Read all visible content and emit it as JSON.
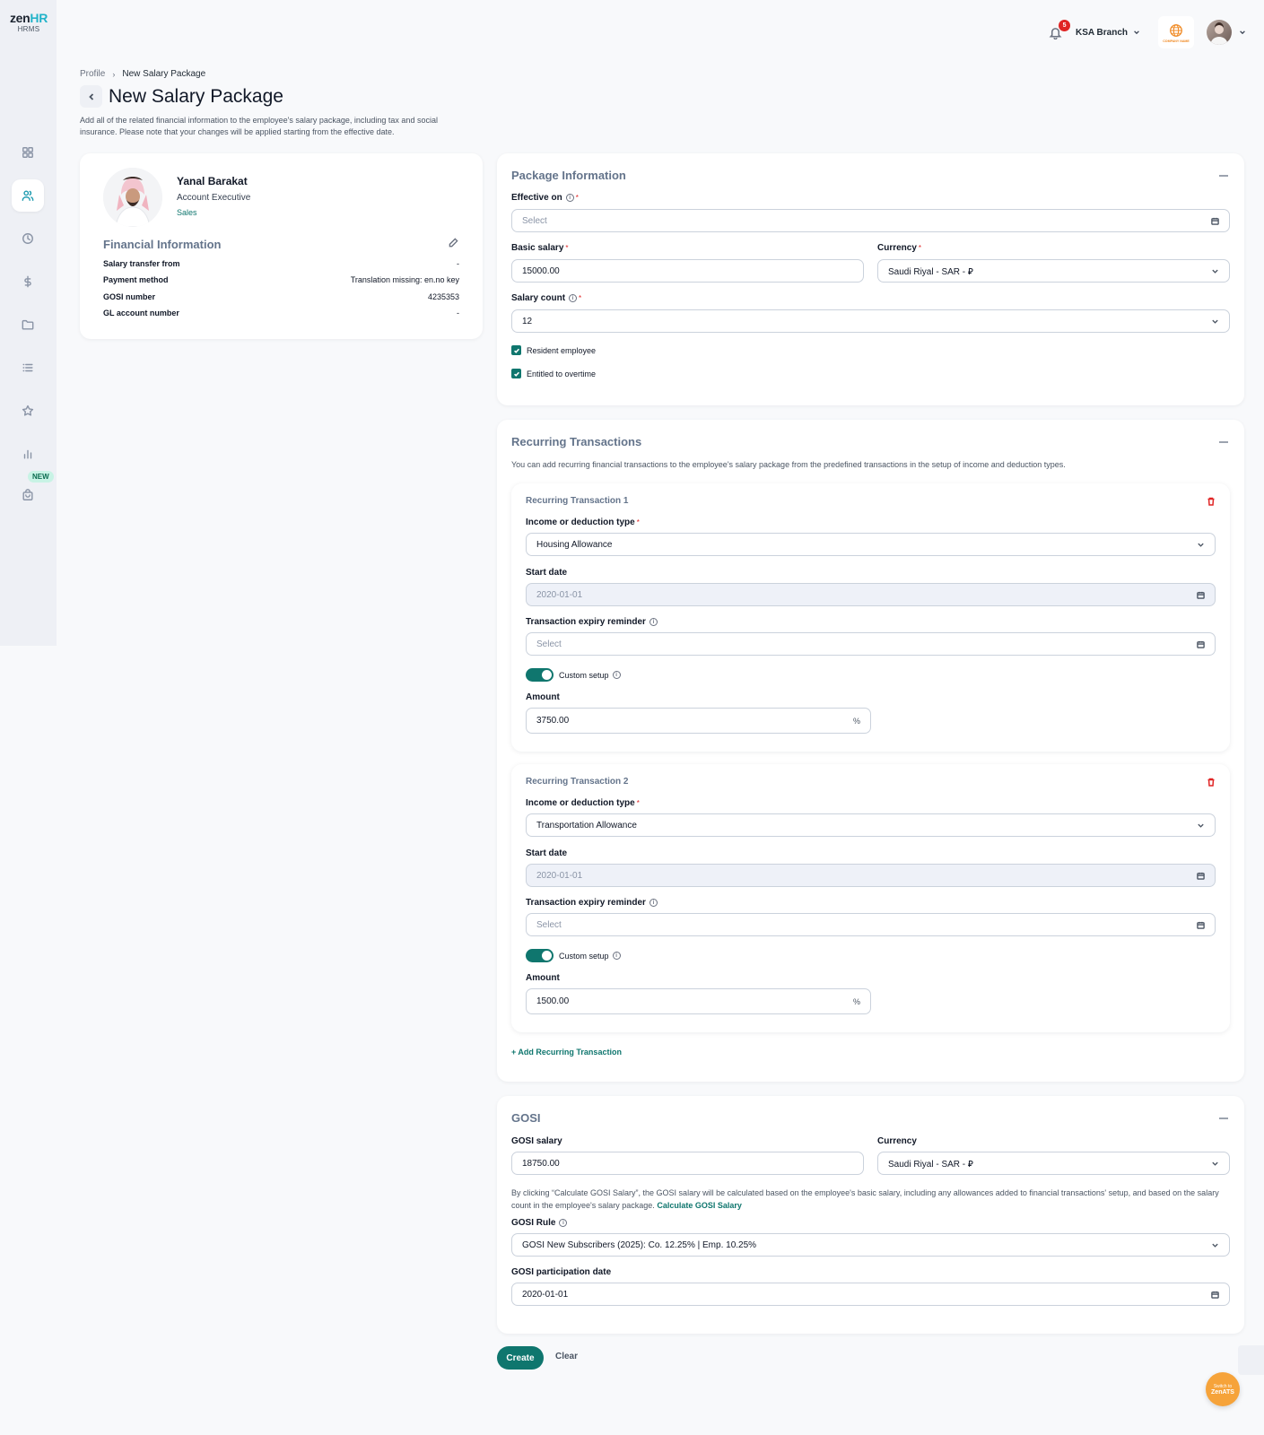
{
  "app": {
    "logo_main": "zen",
    "logo_accent": "HR",
    "logo_sub": "HRMS",
    "new_badge": "NEW"
  },
  "topbar": {
    "notifications_count": "5",
    "branch": "KSA Branch",
    "company_logo_text": "COMPANY NAME"
  },
  "breadcrumb": {
    "root": "Profile",
    "current": "New Salary Package"
  },
  "page": {
    "title": "New Salary Package",
    "description": "Add all of the related financial information to the employee's salary package, including tax and social insurance. Please note that your changes will be applied starting from the effective date."
  },
  "employee": {
    "name": "Yanal Barakat",
    "title": "Account Executive",
    "department": "Sales",
    "financial_title": "Financial Information",
    "rows": [
      {
        "key": "Salary transfer from",
        "value": "-"
      },
      {
        "key": "Payment method",
        "value": "Translation missing: en.no key"
      },
      {
        "key": "GOSI number",
        "value": "4235353"
      },
      {
        "key": "GL account number",
        "value": "-"
      }
    ]
  },
  "package": {
    "title": "Package Information",
    "effective_label": "Effective on",
    "effective_placeholder": "Select",
    "basic_salary_label": "Basic salary",
    "basic_salary_value": "15000.00",
    "currency_label": "Currency",
    "currency_value": "Saudi Riyal - SAR - ⃁",
    "salary_count_label": "Salary count",
    "salary_count_value": "12",
    "resident_label": "Resident employee",
    "overtime_label": "Entitled to overtime"
  },
  "recurring": {
    "title": "Recurring Transactions",
    "description": "You can add recurring financial transactions to the employee's salary package from the predefined transactions in the setup of income and deduction types.",
    "type_label": "Income or deduction type",
    "start_label": "Start date",
    "expiry_label": "Transaction expiry reminder",
    "custom_label": "Custom setup",
    "amount_label": "Amount",
    "select_placeholder": "Select",
    "pct": "%",
    "items": [
      {
        "title": "Recurring Transaction 1",
        "type": "Housing Allowance",
        "start": "2020-01-01",
        "amount": "3750.00"
      },
      {
        "title": "Recurring Transaction 2",
        "type": "Transportation Allowance",
        "start": "2020-01-01",
        "amount": "1500.00"
      }
    ],
    "add_label": "+ Add Recurring Transaction"
  },
  "gosi": {
    "title": "GOSI",
    "salary_label": "GOSI salary",
    "salary_value": "18750.00",
    "currency_label": "Currency",
    "currency_value": "Saudi Riyal - SAR - ⃁",
    "desc_text": "By clicking “Calculate GOSI Salary”, the GOSI salary will be calculated based on the employee's basic salary, including any allowances added to financial transactions' setup, and based on the salary count in the employee's salary package.",
    "calc_link": "Calculate GOSI Salary",
    "rule_label": "GOSI Rule",
    "rule_value": "GOSI New Subscribers (2025): Co. 12.25% | Emp. 10.25%",
    "participation_label": "GOSI participation date",
    "participation_value": "2020-01-01"
  },
  "actions": {
    "create": "Create",
    "clear": "Clear"
  },
  "switch_ats": {
    "line1": "Switch to",
    "line2": "ZenATS"
  },
  "colors": {
    "primary": "#0f766e",
    "accent": "#22b3c9",
    "danger": "#e02424",
    "orange": "#f6a33a"
  }
}
